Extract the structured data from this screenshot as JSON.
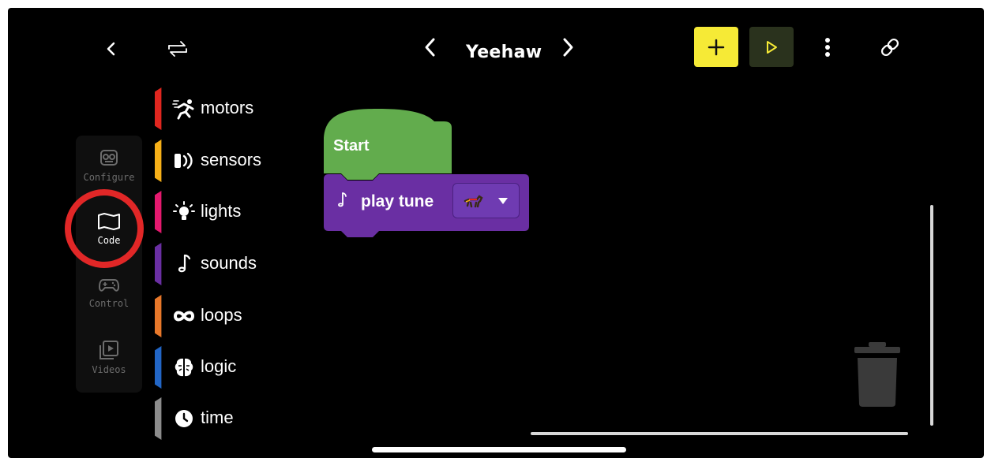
{
  "header": {
    "project_title": "Yeehaw",
    "icons": {
      "back": "chevron-left-icon",
      "switch": "swap-arrows-icon",
      "prev": "chevron-left-icon",
      "next": "chevron-right-icon",
      "add": "plus-icon",
      "play": "play-icon",
      "more": "more-vertical-icon",
      "link": "link-icon"
    },
    "colors": {
      "add_button": "#f6ea36",
      "play_button": "#2a321d",
      "play_glyph": "#f6ea36"
    }
  },
  "sidebar": {
    "items": [
      {
        "label": "Configure",
        "icon": "robot-face-icon",
        "active": false
      },
      {
        "label": "Code",
        "icon": "code-map-icon",
        "active": true
      },
      {
        "label": "Control",
        "icon": "gamepad-icon",
        "active": false
      },
      {
        "label": "Videos",
        "icon": "video-play-icon",
        "active": false
      }
    ],
    "highlight_color": "#e12727"
  },
  "categories": [
    {
      "label": "motors",
      "icon": "running-person-icon",
      "color": "#e0261f"
    },
    {
      "label": "sensors",
      "icon": "sensor-waves-icon",
      "color": "#f7b018"
    },
    {
      "label": "lights",
      "icon": "light-bulb-icon",
      "color": "#e5196e"
    },
    {
      "label": "sounds",
      "icon": "music-note-icon",
      "color": "#6a2fa3"
    },
    {
      "label": "loops",
      "icon": "infinity-icon",
      "color": "#e8782a"
    },
    {
      "label": "logic",
      "icon": "brain-icon",
      "color": "#2266c6"
    },
    {
      "label": "time",
      "icon": "clock-icon",
      "color": "#8c8c8c"
    }
  ],
  "blocks": {
    "start": {
      "label": "Start",
      "color": "#62ac4d"
    },
    "play_tune": {
      "label": "play tune",
      "color": "#6a2fa3",
      "dropdown_value_icon": "horse-icon",
      "dropdown_icon": "caret-down-icon"
    }
  },
  "canvas": {
    "trash_icon": "trash-can-icon"
  }
}
